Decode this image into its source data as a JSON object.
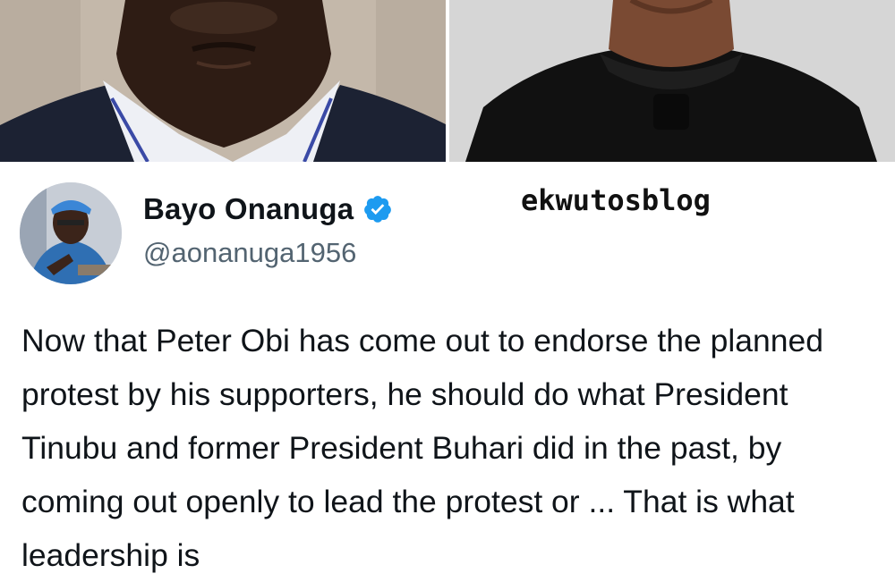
{
  "tweet": {
    "display_name": "Bayo Onanuga",
    "handle": "@aonanuga1956",
    "verified": true,
    "verified_color": "#1d9bf0",
    "text": "Now that Peter Obi has come out to endorse the planned protest by his supporters, he should do what President Tinubu and former President Buhari did in the past, by coming out openly to lead the protest or ... That is what leadership is"
  },
  "watermark": {
    "text": "ekwutosblog"
  },
  "icons": {
    "verified": "verified-badge-icon"
  }
}
